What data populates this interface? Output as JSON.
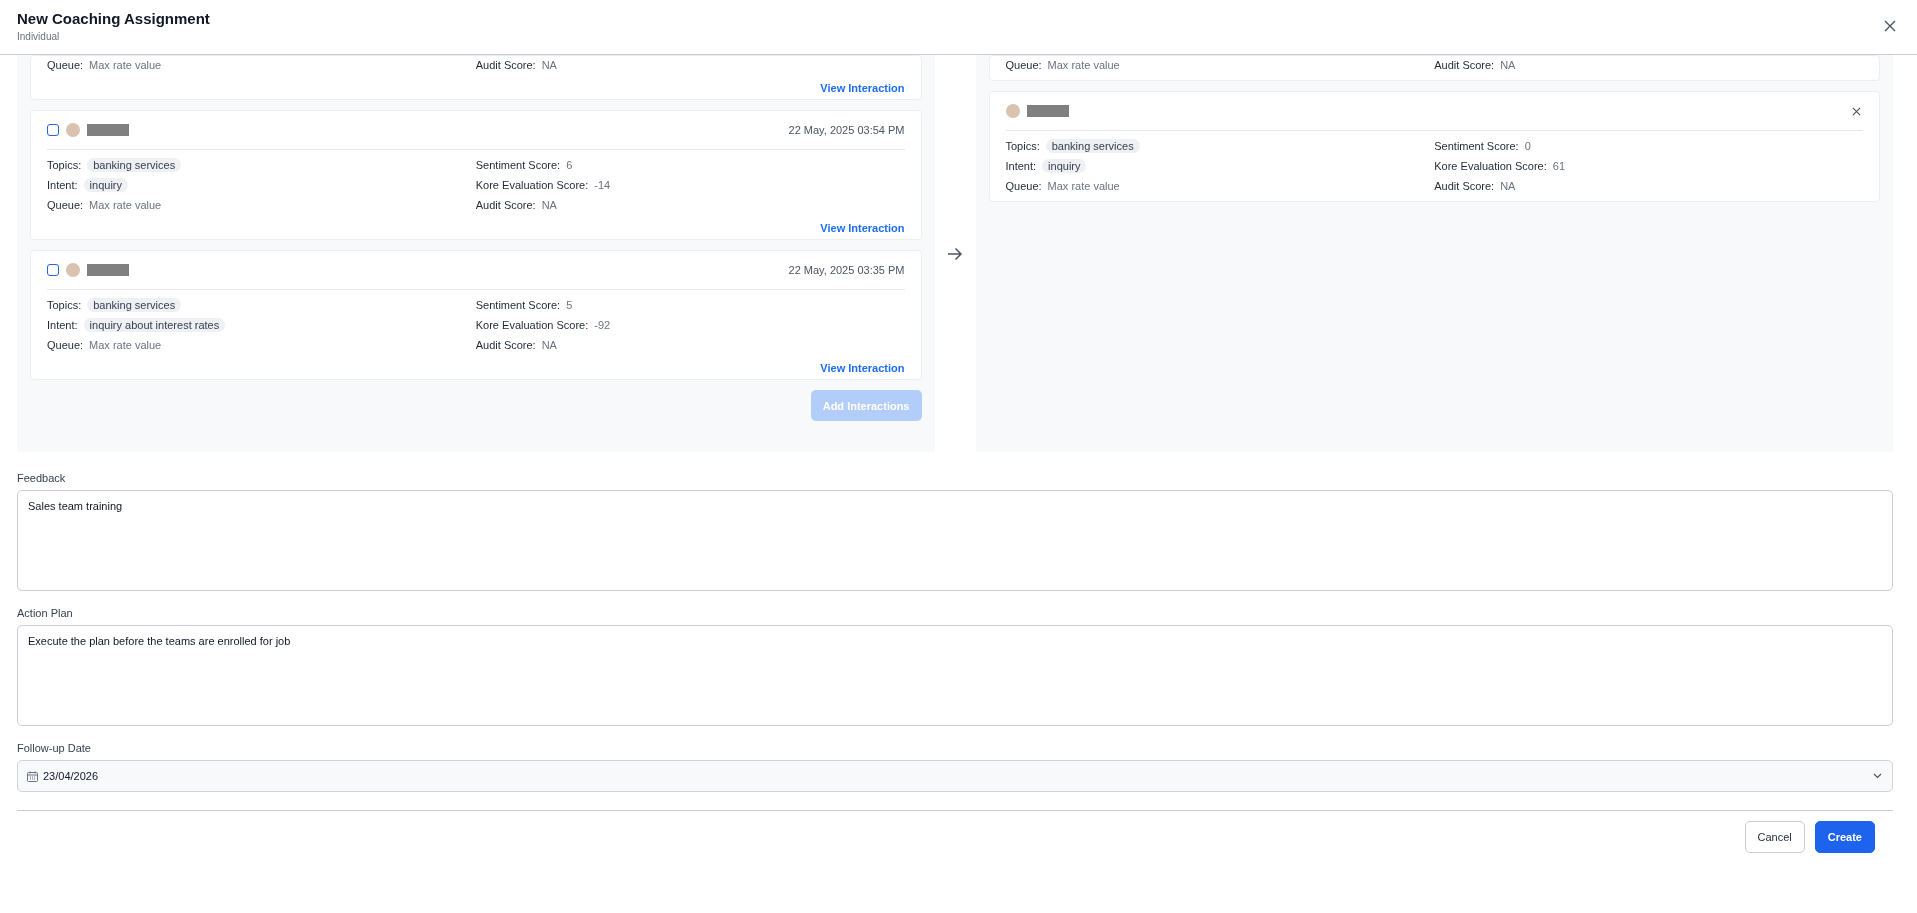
{
  "dialog": {
    "title": "New Coaching Assignment",
    "subtitle": "Individual"
  },
  "available": {
    "items": [
      {
        "kind": "partial",
        "fields": [
          {
            "label": "Queue:",
            "value": "Max rate value",
            "kind": "plain"
          },
          {
            "label": "Audit Score:",
            "value": "NA",
            "kind": "plain"
          }
        ],
        "link": "View Interaction"
      },
      {
        "kind": "full",
        "checked": false,
        "date": "22 May, 2025 03:54 PM",
        "fields": [
          {
            "label": "Topics:",
            "value": "banking services",
            "kind": "tag"
          },
          {
            "label": "Sentiment Score:",
            "value": "6",
            "kind": "plain"
          },
          {
            "label": "Intent:",
            "value": "inquiry",
            "kind": "tag"
          },
          {
            "label": "Kore Evaluation Score:",
            "value": "-14",
            "kind": "plain"
          },
          {
            "label": "Queue:",
            "value": "Max rate value",
            "kind": "plain"
          },
          {
            "label": "Audit Score:",
            "value": "NA",
            "kind": "plain"
          }
        ],
        "link": "View Interaction"
      },
      {
        "kind": "full",
        "checked": false,
        "date": "22 May, 2025 03:35 PM",
        "fields": [
          {
            "label": "Topics:",
            "value": "banking services",
            "kind": "tag"
          },
          {
            "label": "Sentiment Score:",
            "value": "5",
            "kind": "plain"
          },
          {
            "label": "Intent:",
            "value": "inquiry about interest rates",
            "kind": "tag"
          },
          {
            "label": "Kore Evaluation Score:",
            "value": "-92",
            "kind": "plain"
          },
          {
            "label": "Queue:",
            "value": "Max rate value",
            "kind": "plain"
          },
          {
            "label": "Audit Score:",
            "value": "NA",
            "kind": "plain"
          }
        ],
        "link": "View Interaction"
      }
    ],
    "add_button": {
      "label": "Add Interactions",
      "disabled": true
    }
  },
  "selected": {
    "items": [
      {
        "kind": "partial",
        "fields": [
          {
            "label": "Queue:",
            "value": "Max rate value",
            "kind": "plain"
          },
          {
            "label": "Audit Score:",
            "value": "NA",
            "kind": "plain"
          }
        ]
      },
      {
        "kind": "removable",
        "fields": [
          {
            "label": "Topics:",
            "value": "banking services",
            "kind": "tag"
          },
          {
            "label": "Sentiment Score:",
            "value": "0",
            "kind": "plain"
          },
          {
            "label": "Intent:",
            "value": "inquiry",
            "kind": "tag"
          },
          {
            "label": "Kore Evaluation Score:",
            "value": "61",
            "kind": "plain"
          },
          {
            "label": "Queue:",
            "value": "Max rate value",
            "kind": "plain"
          },
          {
            "label": "Audit Score:",
            "value": "NA",
            "kind": "plain"
          }
        ]
      }
    ]
  },
  "form": {
    "feedback": {
      "label": "Feedback",
      "value": "Sales team training"
    },
    "action_plan": {
      "label": "Action Plan",
      "value": "Execute the plan before the teams are enrolled for job"
    },
    "followup_date": {
      "label": "Follow-up Date",
      "value": "23/04/2026"
    }
  },
  "buttons": [
    {
      "label": "Cancel",
      "kind": "secondary"
    },
    {
      "label": "Create",
      "kind": "primary"
    }
  ]
}
